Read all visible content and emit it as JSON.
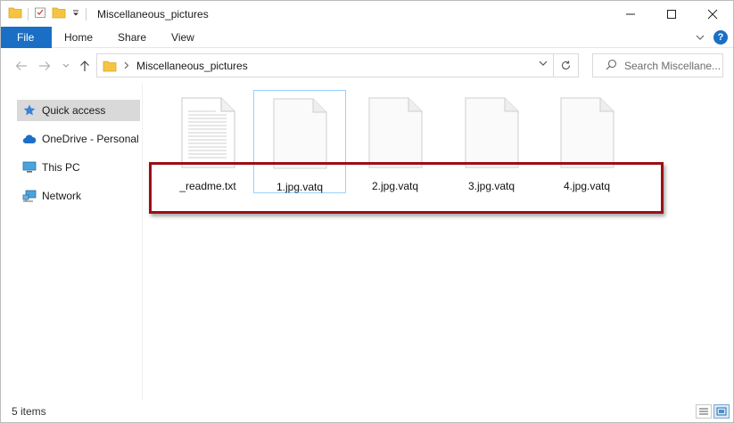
{
  "window": {
    "title": "Miscellaneous_pictures"
  },
  "ribbon": {
    "tabs": [
      "File",
      "Home",
      "Share",
      "View"
    ],
    "help_label": "?"
  },
  "address": {
    "path": "Miscellaneous_pictures",
    "search_placeholder": "Search Miscellane..."
  },
  "sidebar": {
    "items": [
      {
        "label": "Quick access",
        "icon": "star-icon"
      },
      {
        "label": "OneDrive - Personal",
        "icon": "cloud-icon"
      },
      {
        "label": "This PC",
        "icon": "monitor-icon"
      },
      {
        "label": "Network",
        "icon": "network-icon"
      }
    ]
  },
  "files": [
    {
      "name": "_readme.txt",
      "type": "text"
    },
    {
      "name": "1.jpg.vatq",
      "type": "blank"
    },
    {
      "name": "2.jpg.vatq",
      "type": "blank"
    },
    {
      "name": "3.jpg.vatq",
      "type": "blank"
    },
    {
      "name": "4.jpg.vatq",
      "type": "blank"
    }
  ],
  "status": {
    "item_count": "5 items"
  },
  "colors": {
    "accent": "#1a6fc4",
    "highlight_box": "#9b0f15",
    "selection_border": "#99d1ff"
  }
}
